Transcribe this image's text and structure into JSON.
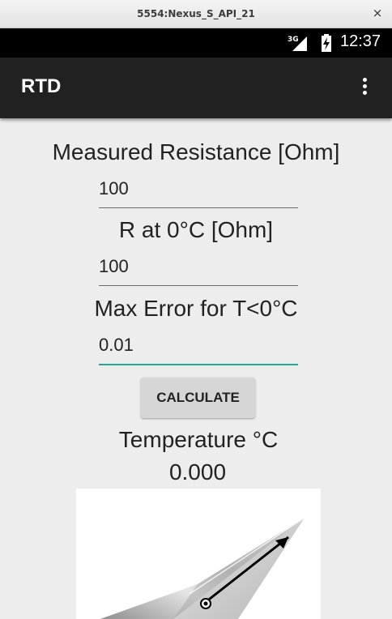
{
  "window": {
    "title": "5554:Nexus_S_API_21",
    "close_glyph": "×"
  },
  "status_bar": {
    "network": "3G",
    "time": "12:37",
    "signal_icon": "cell-signal-icon",
    "battery_icon": "battery-charging-icon"
  },
  "app_bar": {
    "title": "RTD",
    "menu_icon": "more-vertical-icon"
  },
  "form": {
    "measured_resistance": {
      "label": "Measured Resistance [Ohm]",
      "value": "100"
    },
    "r_at_zero": {
      "label": "R at 0°C [Ohm]",
      "value": "100"
    },
    "max_error": {
      "label": "Max Error for T<0°C",
      "value": "0.01"
    },
    "calculate_label": "CALCULATE"
  },
  "result": {
    "label": "Temperature °C",
    "value": "0.000"
  },
  "image": {
    "name": "rtd-probe-image"
  },
  "colors": {
    "app_bar": "#212121",
    "status_bar": "#000000",
    "background": "#ededed",
    "accent": "#26a69a"
  }
}
